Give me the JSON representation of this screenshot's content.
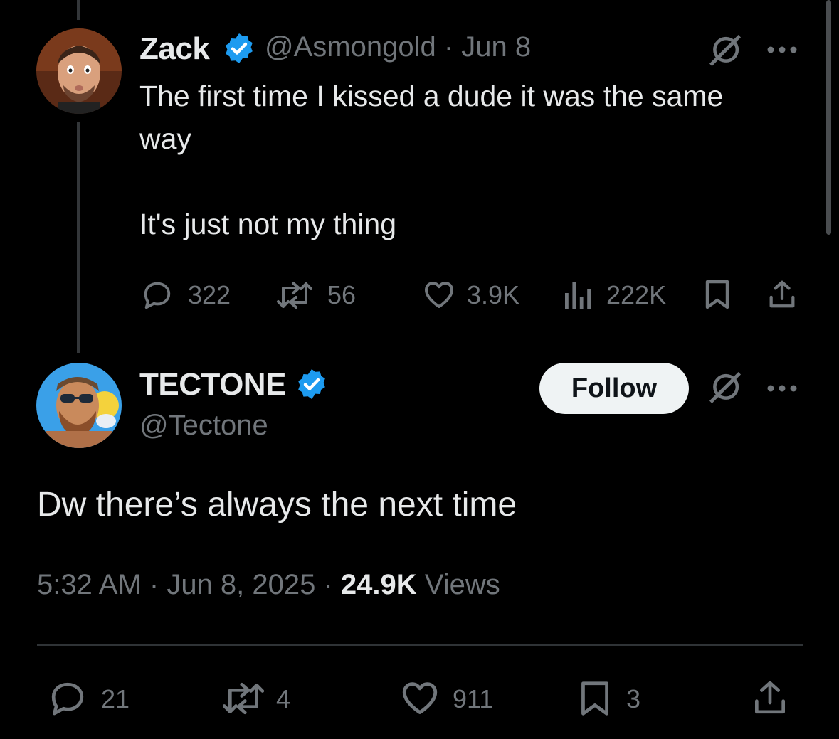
{
  "parent_tweet": {
    "name": "Zack",
    "handle_date": "@Asmongold · Jun 8",
    "text_line1": "The first time I kissed a dude it was the same",
    "text_line2": "way",
    "text_line3": "It's just not my thing",
    "replies": "322",
    "reposts": "56",
    "likes": "3.9K",
    "views": "222K"
  },
  "reply_tweet": {
    "name": "TECTONE",
    "handle": "@Tectone",
    "follow_label": "Follow",
    "text": "Dw there’s always the next time",
    "time": "5:32 AM",
    "date": "Jun 8, 2025",
    "views_count": "24.9K",
    "views_label": "Views",
    "replies": "21",
    "reposts": "4",
    "likes": "911",
    "bookmarks": "3"
  },
  "icons": {
    "verified": "verified-badge-icon",
    "grok": "grok-icon",
    "more": "more-icon",
    "reply": "reply-icon",
    "repost": "repost-icon",
    "like": "like-icon",
    "views": "views-icon",
    "bookmark": "bookmark-icon",
    "share": "share-icon"
  },
  "colors": {
    "background": "#000000",
    "text": "#e7e9ea",
    "muted": "#71767b",
    "verified": "#1d9bf0",
    "follow_bg": "#eff3f4"
  }
}
